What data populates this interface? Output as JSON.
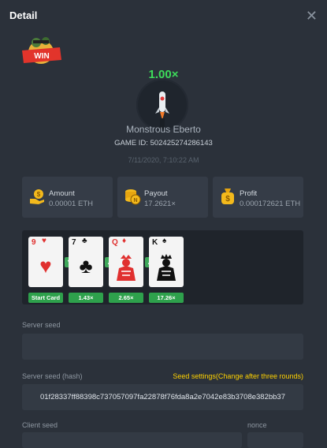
{
  "header": {
    "title": "Detail",
    "close_icon": "close-icon"
  },
  "badge": {
    "text": "WIN"
  },
  "result": {
    "multiplier": "1.00×",
    "player_name": "Monstrous Eberto",
    "game_id": "GAME ID: 502425274286143",
    "time": "7/11/2020, 7:10:22 AM"
  },
  "stats": [
    {
      "label": "Amount",
      "value": "0.00001 ETH",
      "icon": "coin-hand-icon"
    },
    {
      "label": "Payout",
      "value": "17.2621×",
      "icon": "coin-stack-icon"
    },
    {
      "label": "Profit",
      "value": "0.000172621 ETH",
      "icon": "money-bag-icon"
    }
  ],
  "cards": [
    {
      "rank": "9",
      "suit": "♥",
      "color": "red"
    },
    {
      "rank": "7",
      "suit": "♣",
      "color": "black"
    },
    {
      "rank": "Q",
      "suit": "♦",
      "color": "red"
    },
    {
      "rank": "K",
      "suit": "♠",
      "color": "black"
    }
  ],
  "card_buttons": [
    "Start Card",
    "1.43×",
    "2.65×",
    "17.26×"
  ],
  "seeds": {
    "server_seed_label": "Server seed",
    "server_seed_value": "",
    "server_hash_label": "Server seed (hash)",
    "seed_settings": "Seed settings(Change after three rounds)",
    "server_hash_value": "01f28337ff88398c737057097fa22878f76fda8a2e7042e83b3708e382bb37",
    "client_seed_label": "Client seed",
    "nonce_label": "nonce"
  },
  "colors": {
    "accent_green": "#3ddc5a",
    "button_green": "#2ea14c",
    "link_yellow": "#ffd200",
    "background": "#2b313a"
  }
}
